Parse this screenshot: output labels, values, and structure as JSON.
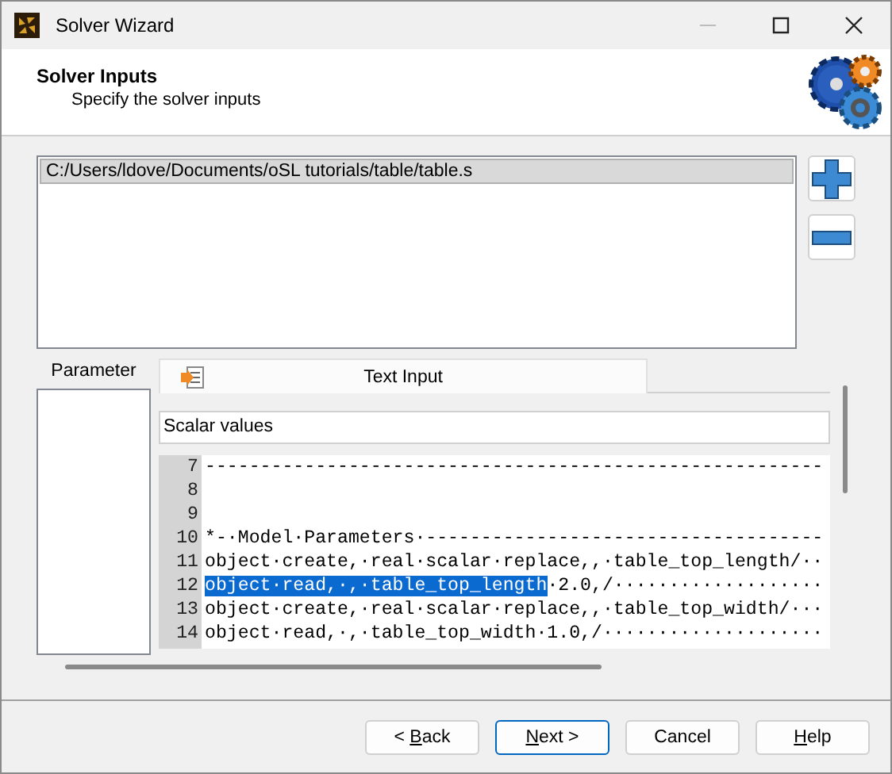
{
  "window": {
    "title": "Solver Wizard"
  },
  "header": {
    "title": "Solver Inputs",
    "subtitle": "Specify the solver inputs"
  },
  "files": {
    "items": [
      {
        "label": "C:/Users/ldove/Documents/oSL tutorials/table/table.s",
        "selected": true
      }
    ]
  },
  "parameter_panel": {
    "label": "Parameter"
  },
  "tabs": [
    {
      "label": "Text Input",
      "selected": true
    }
  ],
  "section_combo": {
    "value": "Scalar values"
  },
  "editor": {
    "lines": [
      {
        "number": "7",
        "segments": [
          {
            "text": "--------------------------------------------------------",
            "selected": false
          }
        ]
      },
      {
        "number": "8"
      },
      {
        "number": "9"
      },
      {
        "number": "10",
        "segments": [
          {
            "text": "*-·Model·Parameters·------------------------------------",
            "selected": false
          }
        ]
      },
      {
        "number": "11",
        "segments": [
          {
            "text": "object·create,·real·scalar·replace,,·table_top_length/··",
            "selected": false
          }
        ]
      },
      {
        "number": "12",
        "segments": [
          {
            "text": "object·read,·,·table_top_length",
            "selected": true
          },
          {
            "text": "·2.0,/···················",
            "selected": false
          }
        ]
      },
      {
        "number": "13",
        "segments": [
          {
            "text": "object·create,·real·scalar·replace,,·table_top_width/···",
            "selected": false
          }
        ]
      },
      {
        "number": "14",
        "segments": [
          {
            "text": "object·read,·,·table_top_width·1.0,/····················",
            "selected": false
          }
        ]
      }
    ]
  },
  "buttons": [
    {
      "label_parts": [
        {
          "text": "< ",
          "underlined": false
        },
        {
          "text": "B",
          "underlined": true
        },
        {
          "text": "ack",
          "underlined": false
        }
      ],
      "default": false
    },
    {
      "label_parts": [
        {
          "text": "N",
          "underlined": true
        },
        {
          "text": "ext >",
          "underlined": false
        }
      ],
      "default": true
    },
    {
      "label_parts": [
        {
          "text": "Cancel",
          "underlined": false
        }
      ],
      "default": false
    },
    {
      "label_parts": [
        {
          "text": "H",
          "underlined": true
        },
        {
          "text": "elp",
          "underlined": false
        }
      ],
      "default": false
    }
  ]
}
